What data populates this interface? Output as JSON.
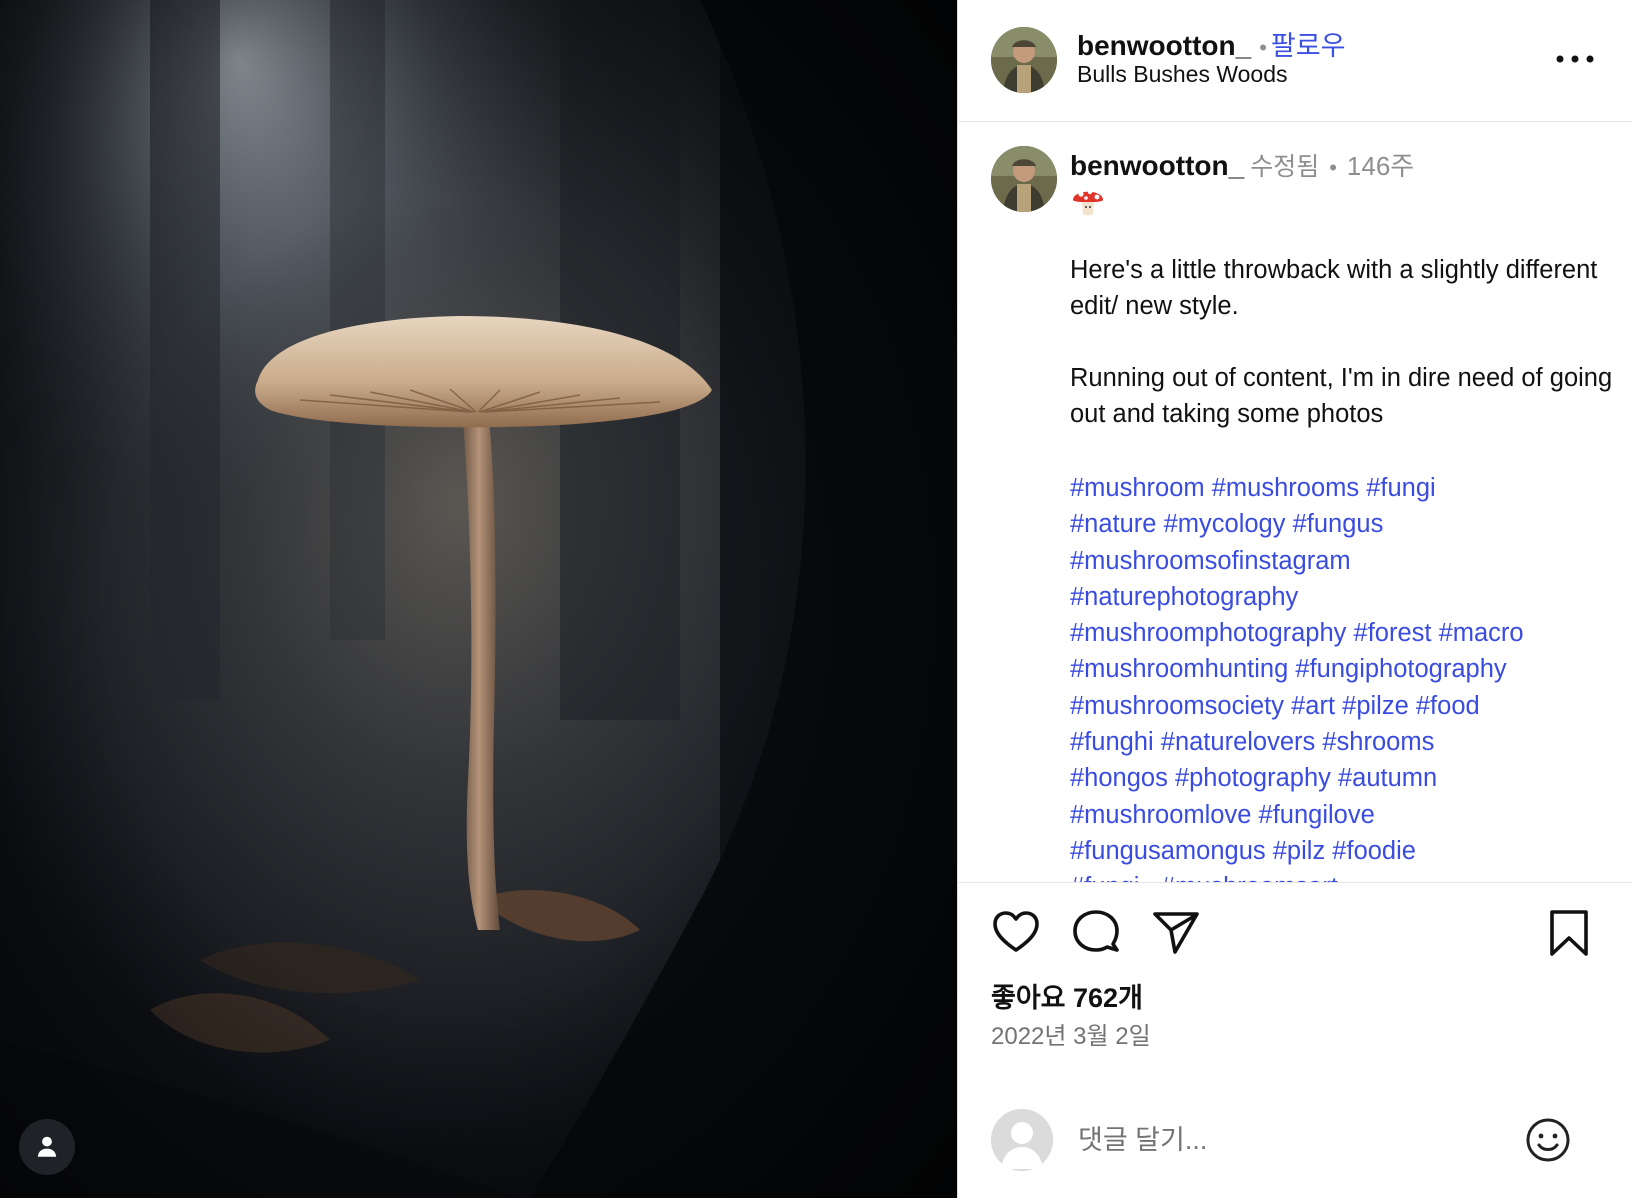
{
  "post": {
    "username": "benwootton_",
    "follow_label": "팔로우",
    "location": "Bulls Bushes Woods",
    "more_icon": "more-horizontal-icon"
  },
  "caption": {
    "username": "benwootton_",
    "edited_label": "수정됨",
    "time_ago": "146주",
    "emoji": "mushroom-emoji",
    "paragraphs": [
      "Here's a little throwback with a slightly different edit/ new style.",
      "Running out of content, I'm in dire need of going out and taking some photos"
    ],
    "hashtag_lines": [
      [
        "#mushroom",
        "#mushrooms",
        "#fungi"
      ],
      [
        "#nature",
        "#mycology",
        "#fungus"
      ],
      [
        "#mushroomsofinstagram"
      ],
      [
        "#naturephotography"
      ],
      [
        "#mushroomphotography",
        "#forest",
        "#macro"
      ],
      [
        "#mushroomhunting",
        "#fungiphotography"
      ],
      [
        "#mushroomsociety",
        "#art",
        "#pilze",
        "#food"
      ],
      [
        "#funghi",
        "#naturelovers",
        "#shrooms"
      ],
      [
        "#hongos",
        "#photography",
        "#autumn"
      ],
      [
        "#mushroomlove",
        "#fungilove"
      ],
      [
        "#fungusamongus",
        "#pilz",
        "#foodie"
      ],
      [
        "#fungi_",
        "#mushroomsart"
      ]
    ]
  },
  "actions": {
    "like_icon": "heart-icon",
    "comment_icon": "comment-icon",
    "share_icon": "share-icon",
    "save_icon": "bookmark-icon"
  },
  "likes_label": "좋아요 762개",
  "date_label": "2022년 3월 2일",
  "comment_box": {
    "placeholder": "댓글 달기...",
    "emoji_icon": "smiley-icon"
  },
  "colors": {
    "link_blue": "#3a4ce0",
    "muted_gray": "#737373"
  }
}
